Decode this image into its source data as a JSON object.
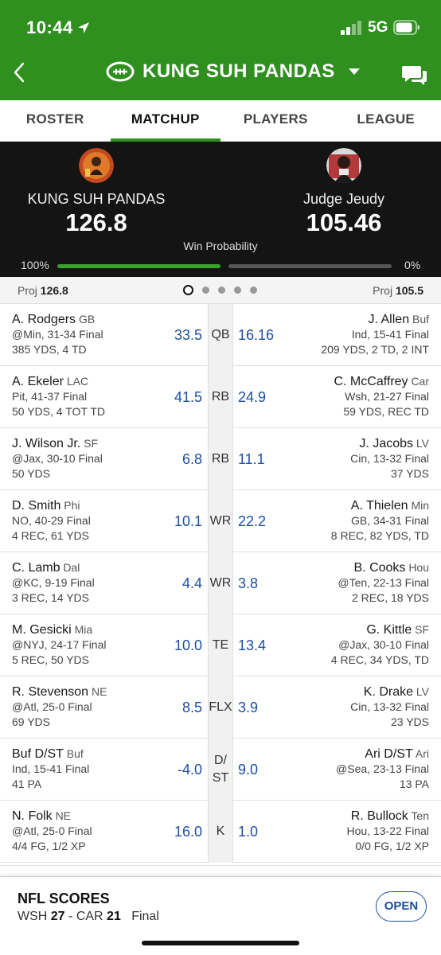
{
  "status_bar": {
    "time": "10:44",
    "network": "5G"
  },
  "header": {
    "team_name": "KUNG SUH PANDAS"
  },
  "tabs": [
    {
      "label": "ROSTER",
      "active": false
    },
    {
      "label": "MATCHUP",
      "active": true
    },
    {
      "label": "PLAYERS",
      "active": false
    },
    {
      "label": "LEAGUE",
      "active": false
    }
  ],
  "scoreboard": {
    "home": {
      "name": "KUNG SUH PANDAS",
      "score": "126.8",
      "win_pct": "100%"
    },
    "away": {
      "name": "Judge Jeudy",
      "score": "105.46",
      "win_pct": "0%"
    },
    "win_label": "Win Probability",
    "win_probability_home": 1.0
  },
  "projection": {
    "label": "Proj",
    "home": "126.8",
    "away": "105.5",
    "page_count": 5,
    "page_active": 1
  },
  "matchup_rows": [
    {
      "pos": "QB",
      "left": {
        "name": "A. Rodgers",
        "team": "GB",
        "game": "@Min, 31-34 Final",
        "stats": "385 YDS, 4 TD",
        "pts": "33.5"
      },
      "right": {
        "name": "J. Allen",
        "team": "Buf",
        "game": "Ind, 15-41 Final",
        "stats": "209 YDS, 2 TD, 2 INT",
        "pts": "16.16"
      }
    },
    {
      "pos": "RB",
      "left": {
        "name": "A. Ekeler",
        "team": "LAC",
        "game": "Pit, 41-37 Final",
        "stats": "50 YDS, 4 TOT TD",
        "pts": "41.5"
      },
      "right": {
        "name": "C. McCaffrey",
        "team": "Car",
        "game": "Wsh, 21-27 Final",
        "stats": "59 YDS, REC TD",
        "pts": "24.9"
      }
    },
    {
      "pos": "RB",
      "left": {
        "name": "J. Wilson Jr.",
        "team": "SF",
        "game": "@Jax, 30-10 Final",
        "stats": "50 YDS",
        "pts": "6.8"
      },
      "right": {
        "name": "J. Jacobs",
        "team": "LV",
        "game": "Cin, 13-32 Final",
        "stats": "37 YDS",
        "pts": "11.1"
      }
    },
    {
      "pos": "WR",
      "left": {
        "name": "D. Smith",
        "team": "Phi",
        "game": "NO, 40-29 Final",
        "stats": "4 REC, 61 YDS",
        "pts": "10.1"
      },
      "right": {
        "name": "A. Thielen",
        "team": "Min",
        "game": "GB, 34-31 Final",
        "stats": "8 REC, 82 YDS, TD",
        "pts": "22.2"
      }
    },
    {
      "pos": "WR",
      "left": {
        "name": "C. Lamb",
        "team": "Dal",
        "game": "@KC, 9-19 Final",
        "stats": "3 REC, 14 YDS",
        "pts": "4.4"
      },
      "right": {
        "name": "B. Cooks",
        "team": "Hou",
        "game": "@Ten, 22-13 Final",
        "stats": "2 REC, 18 YDS",
        "pts": "3.8"
      }
    },
    {
      "pos": "TE",
      "left": {
        "name": "M. Gesicki",
        "team": "Mia",
        "game": "@NYJ, 24-17 Final",
        "stats": "5 REC, 50 YDS",
        "pts": "10.0"
      },
      "right": {
        "name": "G. Kittle",
        "team": "SF",
        "game": "@Jax, 30-10 Final",
        "stats": "4 REC, 34 YDS, TD",
        "pts": "13.4"
      }
    },
    {
      "pos": "FLX",
      "left": {
        "name": "R. Stevenson",
        "team": "NE",
        "game": "@Atl, 25-0 Final",
        "stats": "69 YDS",
        "pts": "8.5"
      },
      "right": {
        "name": "K. Drake",
        "team": "LV",
        "game": "Cin, 13-32 Final",
        "stats": "23 YDS",
        "pts": "3.9"
      }
    },
    {
      "pos": "D/ ST",
      "left": {
        "name": "Buf D/ST",
        "team": "Buf",
        "game": "Ind, 15-41 Final",
        "stats": "41 PA",
        "pts": "-4.0"
      },
      "right": {
        "name": "Ari D/ST",
        "team": "Ari",
        "game": "@Sea, 23-13 Final",
        "stats": "13 PA",
        "pts": "9.0"
      }
    },
    {
      "pos": "K",
      "left": {
        "name": "N. Folk",
        "team": "NE",
        "game": "@Atl, 25-0 Final",
        "stats": "4/4 FG, 1/2 XP",
        "pts": "16.0"
      },
      "right": {
        "name": "R. Bullock",
        "team": "Ten",
        "game": "Hou, 13-22 Final",
        "stats": "0/0 FG, 1/2 XP",
        "pts": "1.0"
      }
    }
  ],
  "scores_bar": {
    "title": "NFL SCORES",
    "away_team": "WSH",
    "away_score": "27",
    "separator": "-",
    "home_team": "CAR",
    "home_score": "21",
    "state": "Final",
    "open_label": "OPEN"
  },
  "colors": {
    "brand_green": "#2f8f1f",
    "link_blue": "#1c4fa3",
    "board_bg": "#141414"
  }
}
